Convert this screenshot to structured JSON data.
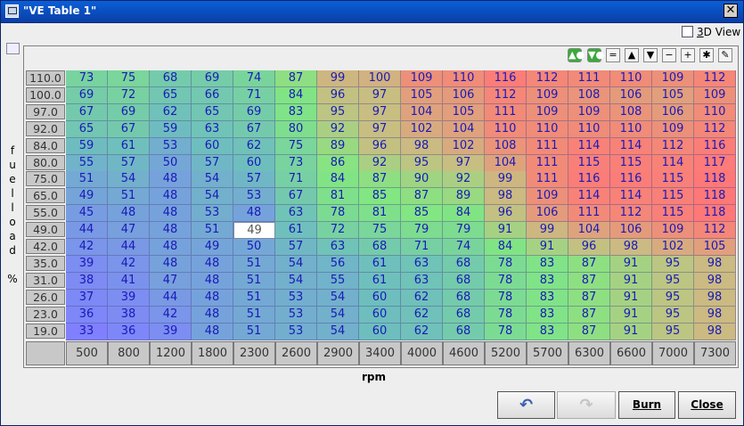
{
  "window": {
    "title": "\"VE Table 1\"",
    "close_glyph": "✕"
  },
  "view3d": {
    "label_prefix": "3",
    "label_rest": "D View",
    "checked": false
  },
  "axes": {
    "y_label_chars": [
      "f",
      "u",
      "e",
      "l",
      "l",
      "o",
      "a",
      "d",
      "",
      "%"
    ],
    "x_label": "rpm"
  },
  "toolbar": {
    "buttons": [
      "▲●",
      "▼●",
      "=",
      "▲",
      "▼",
      "−",
      "+",
      "✱",
      "✎"
    ]
  },
  "table": {
    "row_headers": [
      "110.0",
      "100.0",
      "97.0",
      "92.0",
      "84.0",
      "80.0",
      "75.0",
      "65.0",
      "55.0",
      "49.0",
      "42.0",
      "35.0",
      "31.0",
      "26.0",
      "23.0",
      "19.0"
    ],
    "col_headers": [
      "500",
      "800",
      "1200",
      "1800",
      "2300",
      "2600",
      "2900",
      "3400",
      "4000",
      "4600",
      "5200",
      "5700",
      "6300",
      "6600",
      "7000",
      "7300"
    ],
    "selected": {
      "row": 9,
      "col": 4
    },
    "values": [
      [
        73,
        75,
        68,
        69,
        74,
        87,
        99,
        100,
        109,
        110,
        116,
        112,
        111,
        110,
        109,
        112
      ],
      [
        69,
        72,
        65,
        66,
        71,
        84,
        96,
        97,
        105,
        106,
        112,
        109,
        108,
        106,
        105,
        109
      ],
      [
        67,
        69,
        62,
        65,
        69,
        83,
        95,
        97,
        104,
        105,
        111,
        109,
        109,
        108,
        106,
        110
      ],
      [
        65,
        67,
        59,
        63,
        67,
        80,
        92,
        97,
        102,
        104,
        110,
        110,
        110,
        110,
        109,
        112
      ],
      [
        59,
        61,
        53,
        60,
        62,
        75,
        89,
        96,
        98,
        102,
        108,
        111,
        114,
        114,
        112,
        116
      ],
      [
        55,
        57,
        50,
        57,
        60,
        73,
        86,
        92,
        95,
        97,
        104,
        111,
        115,
        115,
        114,
        117
      ],
      [
        51,
        54,
        48,
        54,
        57,
        71,
        84,
        87,
        90,
        92,
        99,
        111,
        116,
        116,
        115,
        118
      ],
      [
        49,
        51,
        48,
        54,
        53,
        67,
        81,
        85,
        87,
        89,
        98,
        109,
        114,
        114,
        115,
        118
      ],
      [
        45,
        48,
        48,
        53,
        48,
        63,
        78,
        81,
        85,
        84,
        96,
        106,
        111,
        112,
        115,
        118
      ],
      [
        44,
        47,
        48,
        51,
        49,
        61,
        72,
        75,
        79,
        79,
        91,
        99,
        104,
        106,
        109,
        112
      ],
      [
        42,
        44,
        48,
        49,
        50,
        57,
        63,
        68,
        71,
        74,
        84,
        91,
        96,
        98,
        102,
        105
      ],
      [
        39,
        42,
        48,
        48,
        51,
        54,
        56,
        61,
        63,
        68,
        78,
        83,
        87,
        91,
        95,
        98
      ],
      [
        38,
        41,
        47,
        48,
        51,
        54,
        55,
        61,
        63,
        68,
        78,
        83,
        87,
        91,
        95,
        98
      ],
      [
        37,
        39,
        44,
        48,
        51,
        53,
        54,
        60,
        62,
        68,
        78,
        83,
        87,
        91,
        95,
        98
      ],
      [
        36,
        38,
        42,
        48,
        51,
        53,
        54,
        60,
        62,
        68,
        78,
        83,
        87,
        91,
        95,
        98
      ],
      [
        33,
        36,
        39,
        48,
        51,
        53,
        54,
        60,
        62,
        68,
        78,
        83,
        87,
        91,
        95,
        98
      ]
    ]
  },
  "buttons": {
    "undo_icon": "↶",
    "redo_icon": "↷",
    "burn": "Burn",
    "close": "Close"
  }
}
